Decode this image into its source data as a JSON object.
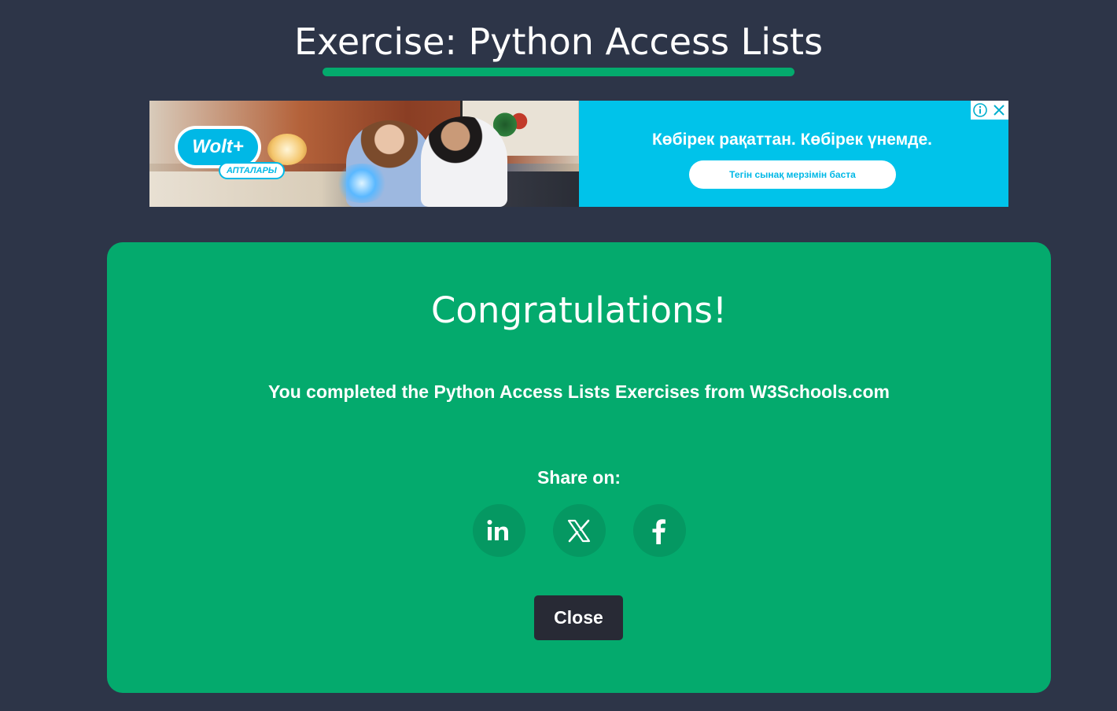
{
  "header": {
    "title": "Exercise: Python Access Lists",
    "accent_color": "#04aa6d"
  },
  "ad": {
    "logo_text": "Wolt+",
    "logo_tag": "АПТАЛАРЫ",
    "headline": "Көбірек рақаттан. Көбірек үнемде.",
    "cta_label": "Тегін сынақ мерзімін баста",
    "info_icon": "info-icon",
    "close_icon": "close-icon",
    "panel_color": "#00c3ea"
  },
  "modal": {
    "heading": "Congratulations!",
    "message": "You completed the Python Access Lists Exercises from W3Schools.com",
    "share_label": "Share on:",
    "share_buttons": [
      {
        "icon": "linkedin-icon",
        "label": "in"
      },
      {
        "icon": "x-icon",
        "label": "X"
      },
      {
        "icon": "facebook-icon",
        "label": "f"
      }
    ],
    "close_label": "Close",
    "background_color": "#04aa6d",
    "close_button_color": "#282a35"
  },
  "page": {
    "background_color": "#2d3548"
  }
}
